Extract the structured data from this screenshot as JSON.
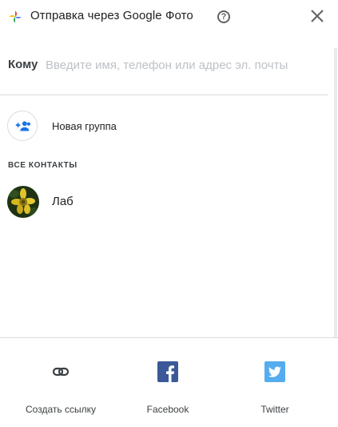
{
  "header": {
    "title": "Отправка через Google Фото",
    "help_symbol": "?",
    "logo_icon": "google-photos-pinwheel-icon",
    "close_icon": "close-icon"
  },
  "recipient": {
    "label": "Кому",
    "placeholder": "Введите имя, телефон или адрес эл. почты",
    "value": ""
  },
  "new_group": {
    "label": "Новая группа",
    "icon": "group-add-icon"
  },
  "contacts": {
    "section_title": "ВСЕ КОНТАКТЫ",
    "items": [
      {
        "name": "Лаб",
        "avatar": "yellow-flower-photo"
      }
    ]
  },
  "share_options": [
    {
      "label": "Создать ссылку",
      "icon": "link-icon"
    },
    {
      "label": "Facebook",
      "icon": "facebook-icon",
      "color": "#3b5998"
    },
    {
      "label": "Twitter",
      "icon": "twitter-icon",
      "color": "#55acee"
    }
  ],
  "colors": {
    "accent": "#1a73e8",
    "divider": "#dadce0",
    "placeholder": "#bdc1c6"
  }
}
